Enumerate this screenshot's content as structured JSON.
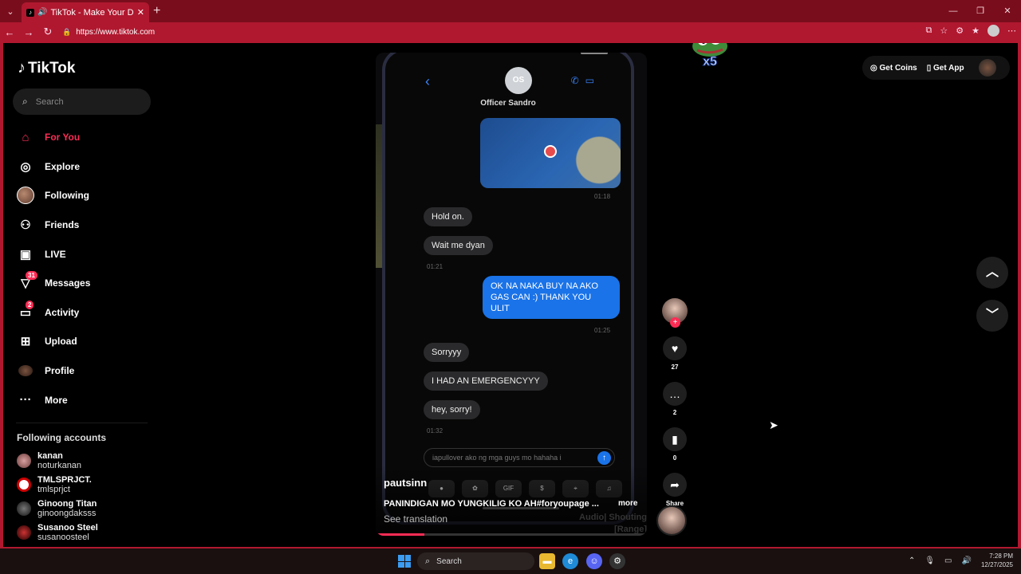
{
  "browser": {
    "tab_title": "TikTok - Make Your Day",
    "url": "https://www.tiktok.com"
  },
  "sidebar": {
    "logo": "TikTok",
    "search_placeholder": "Search",
    "items": [
      {
        "label": "For You",
        "icon": "home-icon"
      },
      {
        "label": "Explore",
        "icon": "compass-icon"
      },
      {
        "label": "Following",
        "icon": "avatar"
      },
      {
        "label": "Friends",
        "icon": "friends-icon"
      },
      {
        "label": "LIVE",
        "icon": "live-icon"
      },
      {
        "label": "Messages",
        "icon": "messages-icon",
        "badge": "31"
      },
      {
        "label": "Activity",
        "icon": "activity-icon",
        "badge": "2"
      },
      {
        "label": "Upload",
        "icon": "upload-icon"
      },
      {
        "label": "Profile",
        "icon": "avatar"
      },
      {
        "label": "More",
        "icon": "more-icon"
      }
    ],
    "following_title": "Following accounts",
    "following": [
      {
        "name": "kanan",
        "user": "noturkanan"
      },
      {
        "name": "TMLSPRJCT.",
        "user": "tmlsprjct"
      },
      {
        "name": "Ginoong Titan",
        "user": "ginoongdaksss"
      },
      {
        "name": "Susanoo Steel",
        "user": "susanoosteel"
      }
    ]
  },
  "video": {
    "contact_initials": "OS",
    "contact_name": "Officer Sandro",
    "messages": [
      {
        "text": "Hold on.",
        "dir": "in"
      },
      {
        "text": "Wait me dyan",
        "dir": "in"
      },
      {
        "text": "OK NA NAKA BUY NA AKO GAS CAN :) THANK YOU ULIT",
        "dir": "out"
      },
      {
        "text": "Sorryyy",
        "dir": "in"
      },
      {
        "text": "I HAD AN EMERGENCYYY",
        "dir": "in"
      },
      {
        "text": "hey, sorry!",
        "dir": "in"
      }
    ],
    "timestamps": [
      "01:18",
      "01:21",
      "01:25",
      "01:32"
    ],
    "compose_text": "iapullover ako ng mga guys mo hahaha i",
    "author": "pautsinn",
    "caption": "PANINDIGAN MO YUNGKILIG KO AH#foryoupage ...",
    "more": "more",
    "see_translation": "See translation",
    "ghost_text": "Audio| Shouting [Range]",
    "progress": 0.18
  },
  "actions": {
    "likes": "27",
    "comments": "2",
    "saves": "0",
    "share": "Share"
  },
  "topbar": {
    "get_coins": "Get Coins",
    "get_app": "Get App",
    "overlay_text": "x5"
  },
  "taskbar": {
    "search": "Search",
    "time": "7:28 PM",
    "date": "12/27/2025"
  },
  "colors": {
    "accent": "#fe2c55",
    "chrome": "#b0182f"
  }
}
